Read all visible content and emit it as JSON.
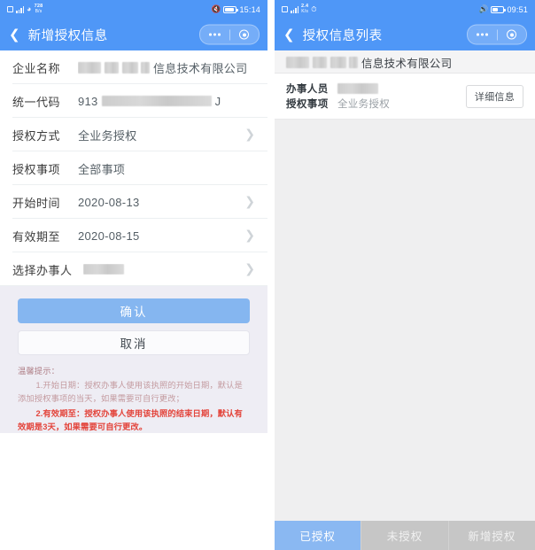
{
  "left": {
    "status_bar": {
      "icons": [
        "sim-card-icon",
        "signal-bars-icon",
        "wifi-icon",
        "network-speed-icon"
      ],
      "network_speed_value": "728",
      "network_speed_unit": "B/s",
      "mute_icon": "mute-icon",
      "battery_level": "89",
      "clock": "15:14"
    },
    "nav": {
      "back_icon": "back-chevron-icon",
      "title": "新增授权信息",
      "capsule": {
        "more_icon": "more-dots-icon",
        "target_icon": "target-circle-icon"
      }
    },
    "form": {
      "rows": [
        {
          "label": "企业名称",
          "value_suffix": "信息技术有限公司",
          "redacted": true,
          "chevron": false
        },
        {
          "label": "统一代码",
          "value_prefix": "913",
          "value_suffix": "J",
          "redacted": true,
          "chevron": false
        },
        {
          "label": "授权方式",
          "value": "全业务授权",
          "chevron": true
        },
        {
          "label": "授权事项",
          "value": "全部事项",
          "chevron": false
        },
        {
          "label": "开始时间",
          "value": "2020-08-13",
          "chevron": true
        },
        {
          "label": "有效期至",
          "value": "2020-08-15",
          "chevron": true
        },
        {
          "label": "选择办事人",
          "value": "",
          "redacted": true,
          "chevron": true
        }
      ]
    },
    "actions": {
      "confirm_label": "确认",
      "cancel_label": "取消"
    },
    "tips": {
      "title": "温馨提示：",
      "item1": "1.开始日期：授权办事人使用该执照的开始日期，默认是添加授权事项的当天，如果需要可自行更改；",
      "item2": "2.有效期至：授权办事人使用该执照的结束日期，默认有效期是3天，如果需要可自行更改。"
    }
  },
  "right": {
    "status_bar": {
      "icons": [
        "sim-card-icon",
        "signal-bars-icon",
        "network-speed-icon",
        "alarm-icon"
      ],
      "network_speed_value": "2.4",
      "network_speed_unit": "K/s",
      "alarm_icon": "alarm-clock-icon",
      "volume_icon": "volume-icon",
      "battery_level": "46",
      "clock": "09:51"
    },
    "nav": {
      "back_icon": "back-chevron-icon",
      "title": "授权信息列表",
      "capsule": {
        "more_icon": "more-dots-icon",
        "target_icon": "target-circle-icon"
      }
    },
    "company_header": {
      "name_suffix": "信息技术有限公司",
      "redacted": true
    },
    "record": {
      "fields": [
        {
          "label": "办事人员",
          "value": "",
          "redacted": true
        },
        {
          "label": "授权事项",
          "value": "全业务授权",
          "redacted": false
        }
      ],
      "detail_button": "详细信息"
    },
    "tabs": [
      {
        "label": "已授权",
        "active": true
      },
      {
        "label": "未授权",
        "active": false
      },
      {
        "label": "新增授权",
        "active": false
      }
    ]
  },
  "colors": {
    "brand_blue": "#4f97f7",
    "primary_button": "#85b6f0",
    "tab_active": "#8ab8f2",
    "tab_inactive": "#c6c6c6",
    "warning_red": "#e3453c",
    "lavender_bg": "#eeedf4",
    "page_gray": "#efeff0"
  }
}
